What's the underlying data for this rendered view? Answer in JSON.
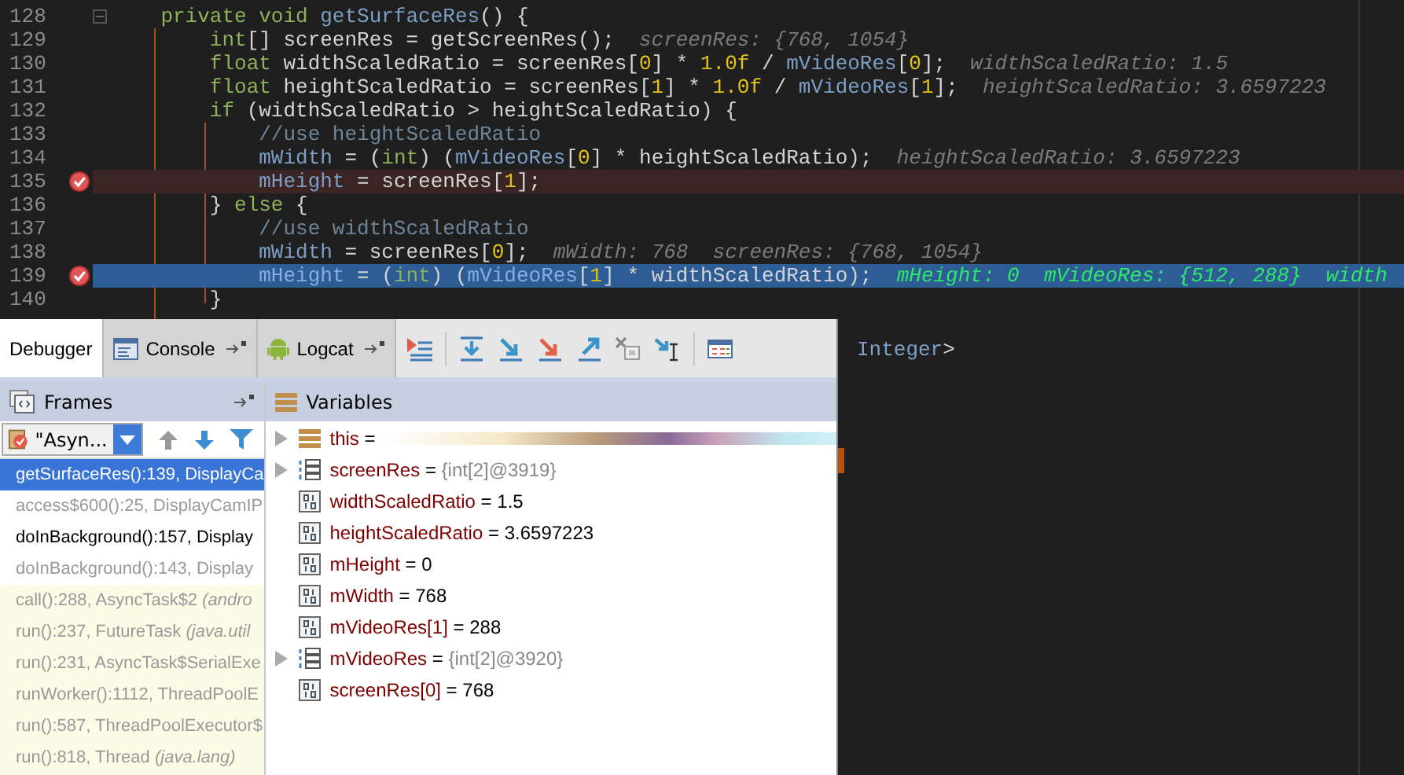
{
  "editor": {
    "lines": [
      {
        "number": "128",
        "breakpoint": false,
        "current": false,
        "fold": true,
        "segments": [
          {
            "kind": "kw",
            "text": "    private void "
          },
          {
            "kind": "method",
            "text": "getSurfaceRes"
          },
          {
            "kind": "plain",
            "text": "() {"
          }
        ]
      },
      {
        "number": "129",
        "breakpoint": false,
        "current": false,
        "fold": false,
        "segments": [
          {
            "kind": "kw",
            "text": "        int"
          },
          {
            "kind": "plain",
            "text": "[] screenRes = getScreenRes();"
          },
          {
            "kind": "hint",
            "text": "screenRes: {768, 1054}"
          }
        ]
      },
      {
        "number": "130",
        "breakpoint": false,
        "current": false,
        "fold": false,
        "segments": [
          {
            "kind": "kw",
            "text": "        float"
          },
          {
            "kind": "plain",
            "text": " widthScaledRatio = screenRes["
          },
          {
            "kind": "num",
            "text": "0"
          },
          {
            "kind": "plain",
            "text": "] * "
          },
          {
            "kind": "num",
            "text": "1.0f"
          },
          {
            "kind": "plain",
            "text": " / "
          },
          {
            "kind": "field",
            "text": "mVideoRes"
          },
          {
            "kind": "plain",
            "text": "["
          },
          {
            "kind": "num",
            "text": "0"
          },
          {
            "kind": "plain",
            "text": "];"
          },
          {
            "kind": "hint",
            "text": "widthScaledRatio: 1.5"
          }
        ]
      },
      {
        "number": "131",
        "breakpoint": false,
        "current": false,
        "fold": false,
        "segments": [
          {
            "kind": "kw",
            "text": "        float"
          },
          {
            "kind": "plain",
            "text": " heightScaledRatio = screenRes["
          },
          {
            "kind": "num",
            "text": "1"
          },
          {
            "kind": "plain",
            "text": "] * "
          },
          {
            "kind": "num",
            "text": "1.0f"
          },
          {
            "kind": "plain",
            "text": " / "
          },
          {
            "kind": "field",
            "text": "mVideoRes"
          },
          {
            "kind": "plain",
            "text": "["
          },
          {
            "kind": "num",
            "text": "1"
          },
          {
            "kind": "plain",
            "text": "];"
          },
          {
            "kind": "hint",
            "text": "heightScaledRatio: 3.6597223"
          }
        ]
      },
      {
        "number": "132",
        "breakpoint": false,
        "current": false,
        "fold": false,
        "segments": [
          {
            "kind": "kw",
            "text": "        if"
          },
          {
            "kind": "plain",
            "text": " (widthScaledRatio > heightScaledRatio) {"
          }
        ]
      },
      {
        "number": "133",
        "breakpoint": false,
        "current": false,
        "fold": false,
        "segments": [
          {
            "kind": "comment",
            "text": "            //use heightScaledRatio"
          }
        ]
      },
      {
        "number": "134",
        "breakpoint": false,
        "current": false,
        "fold": false,
        "segments": [
          {
            "kind": "field",
            "text": "            mWidth"
          },
          {
            "kind": "plain",
            "text": " = ("
          },
          {
            "kind": "kw",
            "text": "int"
          },
          {
            "kind": "plain",
            "text": ") ("
          },
          {
            "kind": "field",
            "text": "mVideoRes"
          },
          {
            "kind": "plain",
            "text": "["
          },
          {
            "kind": "num",
            "text": "0"
          },
          {
            "kind": "plain",
            "text": "] * heightScaledRatio);"
          },
          {
            "kind": "hint",
            "text": "heightScaledRatio: 3.6597223"
          }
        ]
      },
      {
        "number": "135",
        "breakpoint": true,
        "current": false,
        "fold": false,
        "segments": [
          {
            "kind": "field",
            "text": "            mHeight"
          },
          {
            "kind": "plain",
            "text": " = screenRes["
          },
          {
            "kind": "num",
            "text": "1"
          },
          {
            "kind": "plain",
            "text": "];"
          }
        ]
      },
      {
        "number": "136",
        "breakpoint": false,
        "current": false,
        "fold": false,
        "segments": [
          {
            "kind": "plain",
            "text": "        } "
          },
          {
            "kind": "kw",
            "text": "else"
          },
          {
            "kind": "plain",
            "text": " {"
          }
        ]
      },
      {
        "number": "137",
        "breakpoint": false,
        "current": false,
        "fold": false,
        "segments": [
          {
            "kind": "comment",
            "text": "            //use widthScaledRatio"
          }
        ]
      },
      {
        "number": "138",
        "breakpoint": false,
        "current": false,
        "fold": false,
        "segments": [
          {
            "kind": "field",
            "text": "            mWidth"
          },
          {
            "kind": "plain",
            "text": " = screenRes["
          },
          {
            "kind": "num",
            "text": "0"
          },
          {
            "kind": "plain",
            "text": "];"
          },
          {
            "kind": "hint",
            "text": "mWidth: 768"
          },
          {
            "kind": "hint",
            "text": "screenRes: {768, 1054}"
          }
        ]
      },
      {
        "number": "139",
        "breakpoint": true,
        "current": true,
        "fold": false,
        "segments": [
          {
            "kind": "field",
            "text": "            mHeight"
          },
          {
            "kind": "plain",
            "text": " = ("
          },
          {
            "kind": "kw",
            "text": "int"
          },
          {
            "kind": "plain",
            "text": ") ("
          },
          {
            "kind": "field",
            "text": "mVideoRes"
          },
          {
            "kind": "plain",
            "text": "["
          },
          {
            "kind": "num",
            "text": "1"
          },
          {
            "kind": "plain",
            "text": "] * widthScaledRatio);"
          },
          {
            "kind": "hint",
            "text": "mHeight: 0"
          },
          {
            "kind": "hint",
            "text": "mVideoRes: {512, 288}"
          },
          {
            "kind": "hint",
            "text": "width"
          }
        ]
      },
      {
        "number": "140",
        "breakpoint": false,
        "current": false,
        "fold": false,
        "segments": [
          {
            "kind": "plain",
            "text": "        }"
          }
        ]
      }
    ],
    "obscured_line": [
      {
        "kind": "field",
        "text": "Integer"
      },
      {
        "kind": "plain",
        "text": ">"
      }
    ]
  },
  "debugger": {
    "tabs": [
      {
        "label": "Debugger",
        "selected": true,
        "kind": "plain",
        "pinned": false
      },
      {
        "label": "Console",
        "selected": false,
        "kind": "console",
        "pinned": true
      },
      {
        "label": "Logcat",
        "selected": false,
        "kind": "android",
        "pinned": true
      }
    ],
    "frames": {
      "title": "Frames",
      "thread": "\"Asyn...",
      "items": [
        {
          "text": "getSurfaceRes():139, DisplayCa",
          "selected": true,
          "kind": "app"
        },
        {
          "text": "access$600():25, DisplayCamIP",
          "selected": false,
          "kind": "synthetic"
        },
        {
          "text": "doInBackground():157, Display",
          "selected": false,
          "kind": "app"
        },
        {
          "text": "doInBackground():143, Display",
          "selected": false,
          "kind": "synthetic"
        },
        {
          "text": "call():288, AsyncTask$2 *(andro*",
          "selected": false,
          "kind": "library"
        },
        {
          "text": "run():237, FutureTask *(java.util*",
          "selected": false,
          "kind": "library"
        },
        {
          "text": "run():231, AsyncTask$SerialExe",
          "selected": false,
          "kind": "library"
        },
        {
          "text": "runWorker():1112, ThreadPoolE",
          "selected": false,
          "kind": "library"
        },
        {
          "text": "run():587, ThreadPoolExecutor$",
          "selected": false,
          "kind": "library"
        },
        {
          "text": "run():818, Thread *(java.lang)*",
          "selected": false,
          "kind": "library"
        }
      ]
    },
    "variables": {
      "title": "Variables",
      "items": [
        {
          "name": "this",
          "separator": "=",
          "value": "",
          "kind": "object",
          "expandable": true
        },
        {
          "name": "screenRes",
          "separator": "=",
          "value": "{int[2]@3919}",
          "kind": "array",
          "expandable": true
        },
        {
          "name": "widthScaledRatio",
          "separator": "=",
          "value": "1.5",
          "kind": "primitive",
          "expandable": false
        },
        {
          "name": "heightScaledRatio",
          "separator": "=",
          "value": "3.6597223",
          "kind": "primitive",
          "expandable": false
        },
        {
          "name": "mHeight",
          "separator": "=",
          "value": "0",
          "kind": "primitive",
          "expandable": false
        },
        {
          "name": "mWidth",
          "separator": "=",
          "value": "768",
          "kind": "primitive",
          "expandable": false
        },
        {
          "name": "mVideoRes[1]",
          "separator": "=",
          "value": "288",
          "kind": "primitive",
          "expandable": false
        },
        {
          "name": "mVideoRes",
          "separator": "=",
          "value": "{int[2]@3920}",
          "kind": "array",
          "expandable": true
        },
        {
          "name": "screenRes[0]",
          "separator": "=",
          "value": "768",
          "kind": "primitive",
          "expandable": false
        }
      ]
    }
  }
}
